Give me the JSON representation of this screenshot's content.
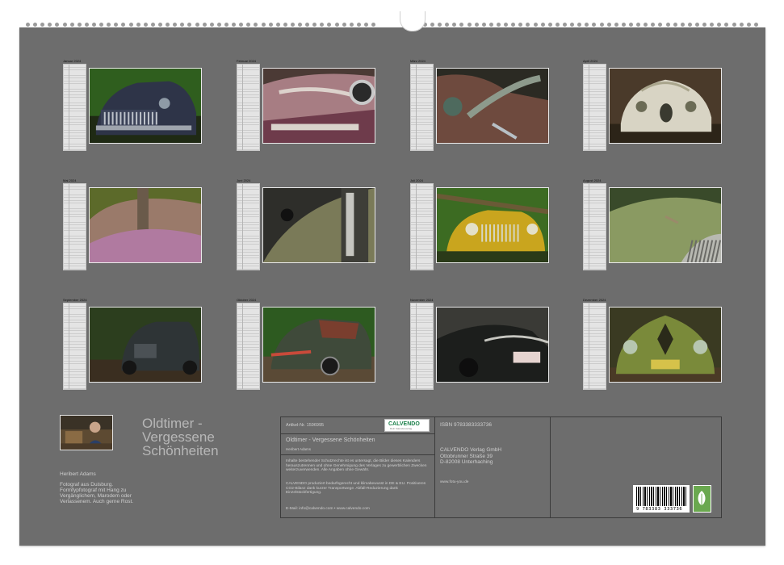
{
  "months": [
    {
      "name": "Januar",
      "year": "2024",
      "scene": "dark-blue-car-forest"
    },
    {
      "name": "Februar",
      "year": "2024",
      "scene": "rusty-chrome-detail"
    },
    {
      "name": "März",
      "year": "2024",
      "scene": "dark-ornament-detail"
    },
    {
      "name": "April",
      "year": "2024",
      "scene": "white-sports-car"
    },
    {
      "name": "Mai",
      "year": "2024",
      "scene": "blurred-fender"
    },
    {
      "name": "Juni",
      "year": "2024",
      "scene": "headlight-detail"
    },
    {
      "name": "Juli",
      "year": "2024",
      "scene": "yellow-car-trees"
    },
    {
      "name": "August",
      "year": "2024",
      "scene": "mossy-hood"
    },
    {
      "name": "September",
      "year": "2024",
      "scene": "dark-car-woods"
    },
    {
      "name": "Oktober",
      "year": "2024",
      "scene": "rusty-car-forest"
    },
    {
      "name": "November",
      "year": "2024",
      "scene": "black-car-plate"
    },
    {
      "name": "Dezember",
      "year": "2024",
      "scene": "green-car-front"
    }
  ],
  "title": {
    "line1": "Oldtimer -",
    "line2": "Vergessene",
    "line3": "Schönheiten"
  },
  "artist": {
    "name": "Heribert Adams",
    "bio": "Fotograf aus Duisburg. Formfypfotograf mit Hang zu Vergänglichem, Marodem oder Verlassenem. Auch gerne Rost."
  },
  "info": {
    "article": "Artikel-Nr. 1596995",
    "logo": "CALVENDO",
    "logo_sub": "Dein Kalenderverlag",
    "calendar_title": "Oldtimer - Vergessene Schönheiten",
    "author": "Heribert Adams",
    "rights": "Inhalte bestehender Schutzrechte ist es untersagt, die Bilder dieses Kalenders herauszutrennen und ohne Genehmigung des Verlages zu gewerblichen Zwecken weiterzuverwenden. Alle Angaben ohne Gewähr.",
    "production": "CALVENDO produziert bedarfsgerecht und klimabewusst in DE & EU. Positiveres CO2-Bilanz dank kurzer Transportwege. Abfall-Reduzierung dank Einzelstückfertigung.",
    "contact": "E-Mail: info@calvendo.com • www.calvendo.com",
    "isbn": "ISBN 9783383333736",
    "publisher_name": "CALVENDO Verlag GmbH",
    "publisher_street": "Ottobrunner Straße 39",
    "publisher_city": "D-82008 Unterhaching",
    "website": "www.fotu-you.de",
    "barcode_number": "9 783383 333736"
  }
}
